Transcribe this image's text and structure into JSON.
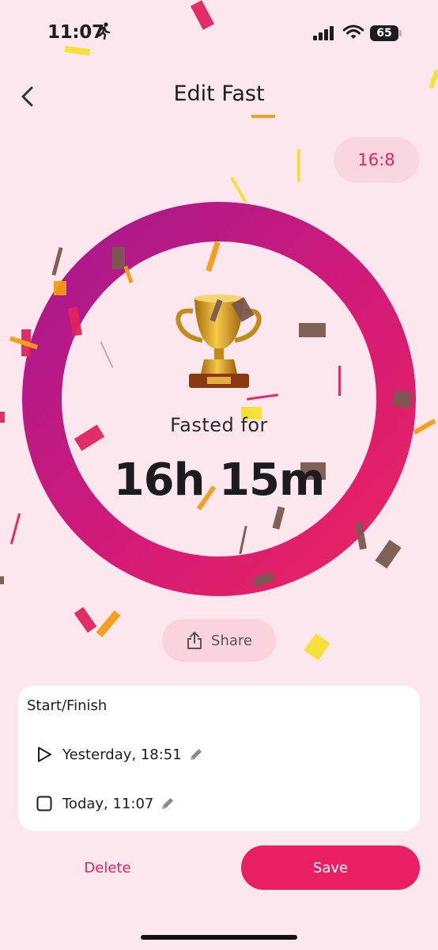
{
  "status_bar": {
    "time": "11:07",
    "battery": "65"
  },
  "header": {
    "title": "Edit Fast",
    "ratio": "16:8"
  },
  "summary": {
    "label": "Fasted for",
    "duration": "16h 15m"
  },
  "share": {
    "label": "Share"
  },
  "times_card": {
    "title": "Start/Finish",
    "start": "Yesterday, 18:51",
    "finish": "Today, 11:07"
  },
  "actions": {
    "delete_label": "Delete",
    "save_label": "Save"
  },
  "colors": {
    "background": "#fce7ee",
    "accent": "#e91e63",
    "ring_start": "#b0188c",
    "ring_end": "#e91e63"
  },
  "icons": [
    "back-chevron-icon",
    "trophy-icon",
    "share-icon",
    "play-icon",
    "stop-square-icon",
    "pencil-icon"
  ]
}
